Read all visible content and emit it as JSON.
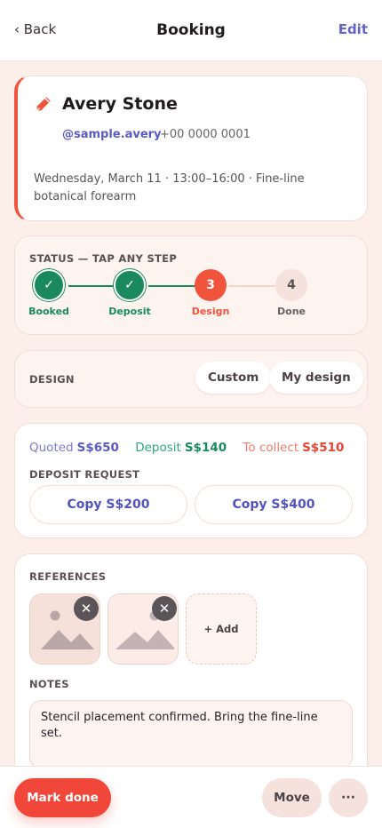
{
  "header": {
    "back_label": "‹ Back",
    "title": "Booking",
    "edit_label": "Edit"
  },
  "client": {
    "name": "Avery Stone",
    "handle": "@sample.avery",
    "phone": "+00 0000 0001",
    "appointment": "Wednesday, March 11 · 13:00–16:00 · Fine-line botanical forearm",
    "icon": "pen-icon",
    "accent_color": "#f0543d"
  },
  "status": {
    "label": "STATUS — TAP ANY STEP",
    "steps": [
      {
        "number": "1",
        "label": "Booked",
        "state": "done"
      },
      {
        "number": "2",
        "label": "Deposit",
        "state": "done"
      },
      {
        "number": "3",
        "label": "Design",
        "state": "current"
      },
      {
        "number": "4",
        "label": "Done",
        "state": "todo"
      }
    ],
    "done_glyph": "✓",
    "colors": {
      "done": "#1a8a5e",
      "current": "#f0543d",
      "todo": "#f6e2dc"
    }
  },
  "design": {
    "label": "DESIGN",
    "options": [
      "Custom",
      "My design"
    ]
  },
  "payment": {
    "quoted_label": "Quoted",
    "quoted_value": "S$650",
    "deposit_label": "Deposit",
    "deposit_value": "S$140",
    "collect_label": "To collect",
    "collect_value": "S$510",
    "request_label": "DEPOSIT REQUEST",
    "copy_buttons": [
      "Copy S$200",
      "Copy S$400"
    ]
  },
  "references": {
    "label": "REFERENCES",
    "remove_glyph": "✕",
    "add_label": "+ Add",
    "notes_label": "NOTES",
    "notes_value": "Stencil placement confirmed. Bring the fine-line set."
  },
  "actions": {
    "mark_done": "Mark done",
    "move": "Move",
    "more": "···"
  }
}
